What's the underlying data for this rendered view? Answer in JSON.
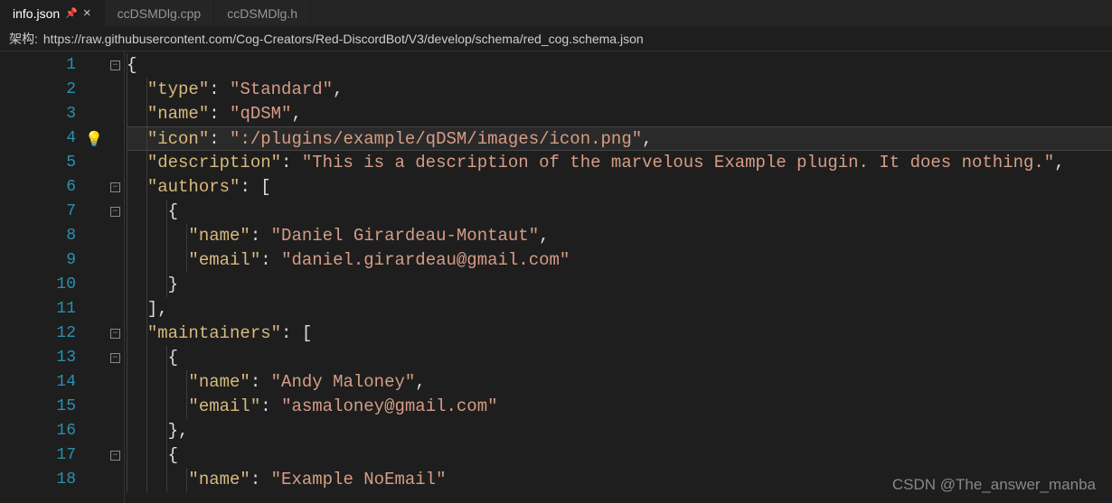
{
  "tabs": [
    {
      "label": "info.json",
      "active": true,
      "pinned": true
    },
    {
      "label": "ccDSMDlg.cpp",
      "active": false,
      "pinned": false
    },
    {
      "label": "ccDSMDlg.h",
      "active": false,
      "pinned": false
    }
  ],
  "schemaBar": {
    "label": "架构:",
    "url": "https://raw.githubusercontent.com/Cog-Creators/Red-DiscordBot/V3/develop/schema/red_cog.schema.json"
  },
  "lineNumbers": [
    "1",
    "2",
    "3",
    "4",
    "5",
    "6",
    "7",
    "8",
    "9",
    "10",
    "11",
    "12",
    "13",
    "14",
    "15",
    "16",
    "17",
    "18"
  ],
  "lightbulbLine": 4,
  "foldGutter": [
    "minus",
    "",
    "",
    "",
    "",
    "minus",
    "minus",
    "",
    "",
    "",
    "",
    "minus",
    "minus",
    "",
    "",
    "",
    "minus",
    ""
  ],
  "json": {
    "type": "Standard",
    "name": "qDSM",
    "icon": ":/plugins/example/qDSM/images/icon.png",
    "description": "This is a description of the marvelous Example plugin. It does nothing.",
    "authors": [
      {
        "name": "Daniel Girardeau-Montaut",
        "email": "daniel.girardeau@gmail.com"
      }
    ],
    "maintainers": [
      {
        "name": "Andy Maloney",
        "email": "asmaloney@gmail.com"
      },
      {
        "name": "Example NoEmail"
      }
    ]
  },
  "codeLines": [
    {
      "indent": 0,
      "tokens": [
        {
          "t": "brace",
          "v": "{"
        }
      ]
    },
    {
      "indent": 1,
      "tokens": [
        {
          "t": "key",
          "v": "\"type\""
        },
        {
          "t": "colon",
          "v": ": "
        },
        {
          "t": "str",
          "v": "\"Standard\""
        },
        {
          "t": "punc",
          "v": ","
        }
      ]
    },
    {
      "indent": 1,
      "tokens": [
        {
          "t": "key",
          "v": "\"name\""
        },
        {
          "t": "colon",
          "v": ": "
        },
        {
          "t": "str",
          "v": "\"qDSM\""
        },
        {
          "t": "punc",
          "v": ","
        }
      ]
    },
    {
      "indent": 1,
      "highlight": true,
      "tokens": [
        {
          "t": "key",
          "v": "\"icon\""
        },
        {
          "t": "colon",
          "v": ": "
        },
        {
          "t": "str",
          "v": "\":/plugins/example/qDSM/images/icon.png\""
        },
        {
          "t": "punc",
          "v": ","
        }
      ]
    },
    {
      "indent": 1,
      "tokens": [
        {
          "t": "key",
          "v": "\"description\""
        },
        {
          "t": "colon",
          "v": ": "
        },
        {
          "t": "str",
          "v": "\"This is a description of the marvelous Example plugin. It does nothing.\""
        },
        {
          "t": "punc",
          "v": ","
        }
      ]
    },
    {
      "indent": 1,
      "tokens": [
        {
          "t": "key",
          "v": "\"authors\""
        },
        {
          "t": "colon",
          "v": ": "
        },
        {
          "t": "brace",
          "v": "["
        }
      ]
    },
    {
      "indent": 2,
      "tokens": [
        {
          "t": "brace",
          "v": "{"
        }
      ]
    },
    {
      "indent": 3,
      "tokens": [
        {
          "t": "key",
          "v": "\"name\""
        },
        {
          "t": "colon",
          "v": ": "
        },
        {
          "t": "str",
          "v": "\"Daniel Girardeau-Montaut\""
        },
        {
          "t": "punc",
          "v": ","
        }
      ]
    },
    {
      "indent": 3,
      "tokens": [
        {
          "t": "key",
          "v": "\"email\""
        },
        {
          "t": "colon",
          "v": ": "
        },
        {
          "t": "str",
          "v": "\"daniel.girardeau@gmail.com\""
        }
      ]
    },
    {
      "indent": 2,
      "tokens": [
        {
          "t": "brace",
          "v": "}"
        }
      ]
    },
    {
      "indent": 1,
      "tokens": [
        {
          "t": "brace",
          "v": "]"
        },
        {
          "t": "punc",
          "v": ","
        }
      ]
    },
    {
      "indent": 1,
      "tokens": [
        {
          "t": "key",
          "v": "\"maintainers\""
        },
        {
          "t": "colon",
          "v": ": "
        },
        {
          "t": "brace",
          "v": "["
        }
      ]
    },
    {
      "indent": 2,
      "tokens": [
        {
          "t": "brace",
          "v": "{"
        }
      ]
    },
    {
      "indent": 3,
      "tokens": [
        {
          "t": "key",
          "v": "\"name\""
        },
        {
          "t": "colon",
          "v": ": "
        },
        {
          "t": "str",
          "v": "\"Andy Maloney\""
        },
        {
          "t": "punc",
          "v": ","
        }
      ]
    },
    {
      "indent": 3,
      "tokens": [
        {
          "t": "key",
          "v": "\"email\""
        },
        {
          "t": "colon",
          "v": ": "
        },
        {
          "t": "str",
          "v": "\"asmaloney@gmail.com\""
        }
      ]
    },
    {
      "indent": 2,
      "tokens": [
        {
          "t": "brace",
          "v": "}"
        },
        {
          "t": "punc",
          "v": ","
        }
      ]
    },
    {
      "indent": 2,
      "tokens": [
        {
          "t": "brace",
          "v": "{"
        }
      ]
    },
    {
      "indent": 3,
      "tokens": [
        {
          "t": "key",
          "v": "\"name\""
        },
        {
          "t": "colon",
          "v": ": "
        },
        {
          "t": "str",
          "v": "\"Example NoEmail\""
        }
      ]
    }
  ],
  "watermark": "CSDN @The_answer_manba"
}
